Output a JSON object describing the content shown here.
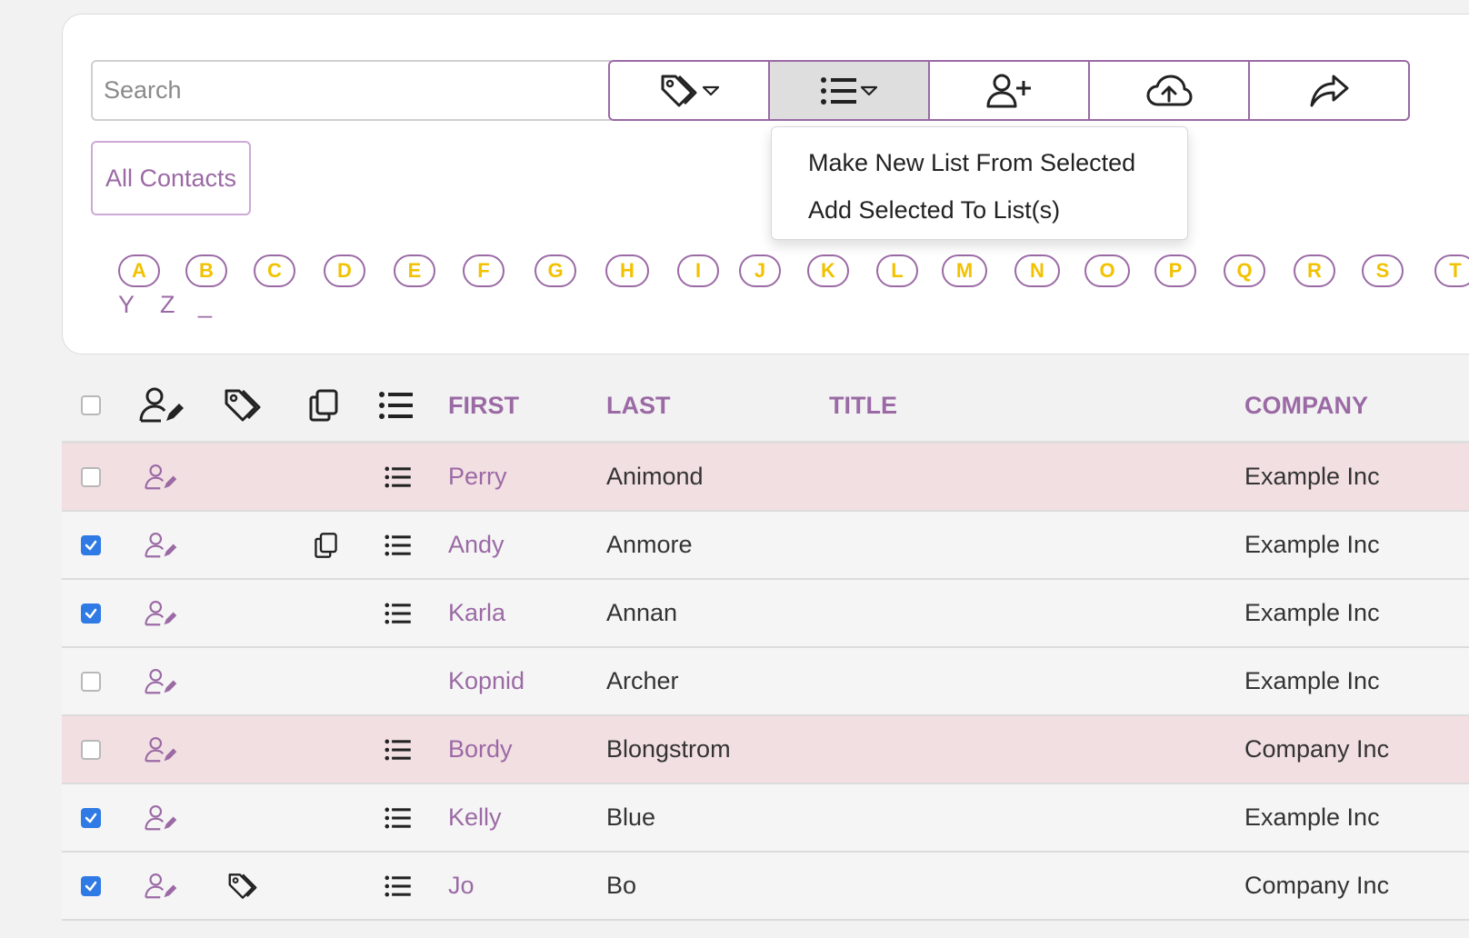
{
  "search": {
    "placeholder": "Search",
    "value": ""
  },
  "toolbar": [
    {
      "icon": "tag-icon",
      "has_caret": true
    },
    {
      "icon": "list-icon",
      "has_caret": true,
      "active": true
    },
    {
      "icon": "add-user-icon"
    },
    {
      "icon": "cloud-upload-icon"
    },
    {
      "icon": "share-icon"
    }
  ],
  "all_contacts_label": "All Contacts",
  "dropdown": {
    "items": [
      "Make New List From Selected",
      "Add Selected To List(s)"
    ]
  },
  "letters": [
    "A",
    "B",
    "C",
    "D",
    "E",
    "F",
    "G",
    "H",
    "I",
    "J",
    "K",
    "L",
    "M",
    "N",
    "O",
    "P",
    "Q",
    "R",
    "S",
    "T"
  ],
  "letters_row2": [
    "Y",
    "Z",
    "_"
  ],
  "table": {
    "headers": {
      "first": "FIRST",
      "last": "LAST",
      "title": "TITLE",
      "company": "COMPANY"
    },
    "rows": [
      {
        "checked": false,
        "tag": false,
        "copy": false,
        "list": true,
        "first": "Perry",
        "last": "Animond",
        "title": "",
        "company": "Example Inc",
        "highlight": true
      },
      {
        "checked": true,
        "tag": false,
        "copy": true,
        "list": true,
        "first": "Andy",
        "last": "Anmore",
        "title": "",
        "company": "Example Inc",
        "highlight": false
      },
      {
        "checked": true,
        "tag": false,
        "copy": false,
        "list": true,
        "first": "Karla",
        "last": "Annan",
        "title": "",
        "company": "Example Inc",
        "highlight": false
      },
      {
        "checked": false,
        "tag": false,
        "copy": false,
        "list": false,
        "first": "Kopnid",
        "last": "Archer",
        "title": "",
        "company": "Example Inc",
        "highlight": false
      },
      {
        "checked": false,
        "tag": false,
        "copy": false,
        "list": true,
        "first": "Bordy",
        "last": "Blongstrom",
        "title": "",
        "company": "Company Inc",
        "highlight": true
      },
      {
        "checked": true,
        "tag": false,
        "copy": false,
        "list": true,
        "first": "Kelly",
        "last": "Blue",
        "title": "",
        "company": "Example Inc",
        "highlight": false
      },
      {
        "checked": true,
        "tag": true,
        "copy": false,
        "list": true,
        "first": "Jo",
        "last": "Bo",
        "title": "",
        "company": "Company Inc",
        "highlight": false
      }
    ]
  },
  "colors": {
    "accent": "#9b6aa5",
    "letter_text": "#f2c200",
    "checkbox": "#2f7ae5",
    "row_highlight": "#f2dfe2"
  }
}
